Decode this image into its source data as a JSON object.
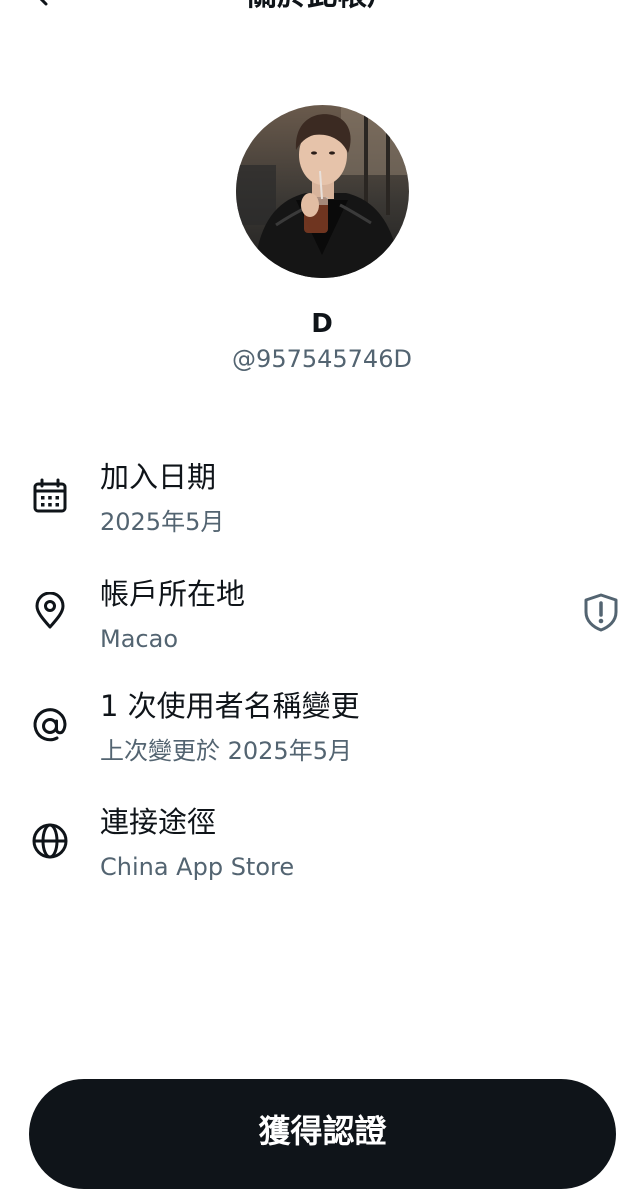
{
  "header": {
    "title": "關於此帳戶",
    "back_icon": "arrow-left-icon"
  },
  "profile": {
    "display_name": "D",
    "handle": "@957545746D"
  },
  "info": {
    "joined": {
      "icon": "calendar-icon",
      "label": "加入日期",
      "value": "2025年5月"
    },
    "location": {
      "icon": "location-pin-icon",
      "label": "帳戶所在地",
      "value": "Macao",
      "badge_icon": "shield-alert-icon"
    },
    "username_changes": {
      "icon": "at-sign-icon",
      "label": "1 次使用者名稱變更",
      "value": "上次變更於 2025年5月"
    },
    "connected_via": {
      "icon": "globe-icon",
      "label": "連接途徑",
      "value": "China App Store"
    }
  },
  "footer": {
    "button_label": "獲得認證"
  },
  "colors": {
    "primary_text": "#0f1419",
    "secondary_text": "#536471",
    "button_bg": "#0f1419",
    "button_text": "#ffffff"
  }
}
